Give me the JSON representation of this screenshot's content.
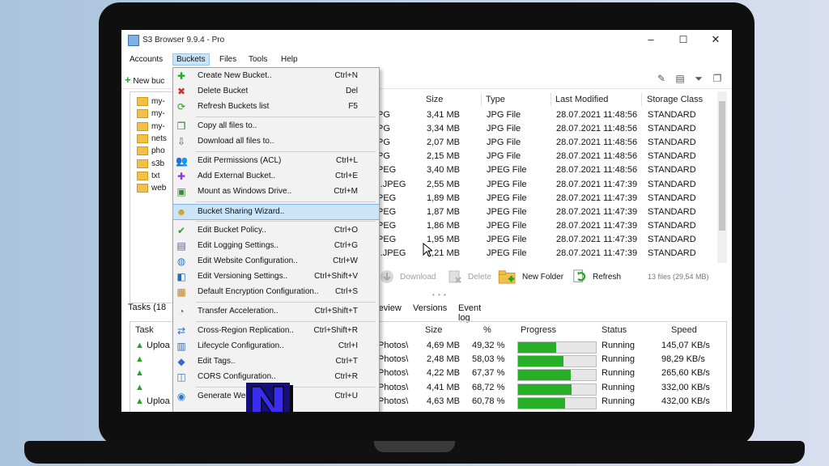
{
  "window": {
    "title": "S3 Browser 9.9.4 - Pro",
    "minimize": "–",
    "maximize": "☐",
    "close": "✕"
  },
  "menubar": {
    "items": [
      "Accounts",
      "Buckets",
      "Files",
      "Tools",
      "Help"
    ],
    "active": "Buckets"
  },
  "toolbar": {
    "new_bucket_label": "New buc",
    "plus": "+"
  },
  "buckets": [
    "my-",
    "my-",
    "my-",
    "nets",
    "pho",
    "s3b",
    "txt",
    "web"
  ],
  "files": {
    "headers": [
      "Size",
      "Type",
      "Last Modified",
      "Storage Class"
    ],
    "rows": [
      {
        "name": "PG",
        "size": "3,41 MB",
        "type": "JPG File",
        "modified": "28.07.2021 11:48:56",
        "storage": "STANDARD"
      },
      {
        "name": "PG",
        "size": "3,34 MB",
        "type": "JPG File",
        "modified": "28.07.2021 11:48:56",
        "storage": "STANDARD"
      },
      {
        "name": "PG",
        "size": "2,07 MB",
        "type": "JPG File",
        "modified": "28.07.2021 11:48:56",
        "storage": "STANDARD"
      },
      {
        "name": "PG",
        "size": "2,15 MB",
        "type": "JPG File",
        "modified": "28.07.2021 11:48:56",
        "storage": "STANDARD"
      },
      {
        "name": "PEG",
        "size": "3,40 MB",
        "type": "JPEG File",
        "modified": "28.07.2021 11:48:56",
        "storage": "STANDARD"
      },
      {
        "name": ").JPEG",
        "size": "2,55 MB",
        "type": "JPEG File",
        "modified": "28.07.2021 11:47:39",
        "storage": "STANDARD"
      },
      {
        "name": "PEG",
        "size": "1,89 MB",
        "type": "JPEG File",
        "modified": "28.07.2021 11:47:39",
        "storage": "STANDARD"
      },
      {
        "name": "PEG",
        "size": "1,87 MB",
        "type": "JPEG File",
        "modified": "28.07.2021 11:47:39",
        "storage": "STANDARD"
      },
      {
        "name": "PEG",
        "size": "1,86 MB",
        "type": "JPEG File",
        "modified": "28.07.2021 11:47:39",
        "storage": "STANDARD"
      },
      {
        "name": "PEG",
        "size": "1,95 MB",
        "type": "JPEG File",
        "modified": "28.07.2021 11:47:39",
        "storage": "STANDARD"
      },
      {
        "name": ").JPEG",
        "size": "1,21 MB",
        "type": "JPEG File",
        "modified": "28.07.2021 11:47:39",
        "storage": "STANDARD"
      }
    ]
  },
  "actions": {
    "download": "Download",
    "delete": "Delete",
    "new_folder": "New Folder",
    "refresh": "Refresh",
    "file_count": "13 files (29,54 MB)",
    "splitter": "• • •"
  },
  "tabs": {
    "tasks": "Tasks (18",
    "items": [
      "review",
      "Versions",
      "Event log"
    ]
  },
  "tasks": {
    "headers": [
      "Task",
      "Size",
      "%",
      "Progress",
      "Status",
      "Speed"
    ],
    "rows": [
      {
        "task": "Uploa",
        "path": "Photos\\",
        "size": "4,69 MB",
        "percent": "49,32 %",
        "progress": 0.4932,
        "status": "Running",
        "speed": "145,07 KB/s"
      },
      {
        "task": "",
        "path": "Photos\\",
        "size": "2,48 MB",
        "percent": "58,03 %",
        "progress": 0.5803,
        "status": "Running",
        "speed": "98,29 KB/s"
      },
      {
        "task": "",
        "path": "Photos\\",
        "size": "4,22 MB",
        "percent": "67,37 %",
        "progress": 0.6737,
        "status": "Running",
        "speed": "265,60 KB/s"
      },
      {
        "task": "",
        "path": "Photos\\",
        "size": "4,41 MB",
        "percent": "68,72 %",
        "progress": 0.6872,
        "status": "Running",
        "speed": "332,00 KB/s"
      },
      {
        "task": "Uploa",
        "path": "Photos\\",
        "size": "4,63 MB",
        "percent": "60,78 %",
        "progress": 0.6078,
        "status": "Running",
        "speed": "432,00 KB/s"
      }
    ]
  },
  "buckets_menu": {
    "items": [
      {
        "label": "Create New Bucket..",
        "shortcut": "Ctrl+N",
        "icon": "plus-icon",
        "glyph": "✚",
        "color": "#22a722"
      },
      {
        "label": "Delete Bucket",
        "shortcut": "Del",
        "icon": "delete-icon",
        "glyph": "✖",
        "color": "#d62b2b"
      },
      {
        "label": "Refresh Buckets list",
        "shortcut": "F5",
        "icon": "refresh-icon",
        "glyph": "⟳",
        "color": "#2a9a2a"
      },
      {
        "sep": true
      },
      {
        "label": "Copy all files to..",
        "shortcut": "",
        "icon": "copy-icon",
        "glyph": "❐",
        "color": "#2a7a2a"
      },
      {
        "label": "Download all files to..",
        "shortcut": "",
        "icon": "download-icon",
        "glyph": "⇩",
        "color": "#2a7a2a"
      },
      {
        "sep": true
      },
      {
        "label": "Edit Permissions (ACL)",
        "shortcut": "Ctrl+L",
        "icon": "users-icon",
        "glyph": "👥",
        "color": "#3a5a9a"
      },
      {
        "label": "Add External Bucket..",
        "shortcut": "Ctrl+E",
        "icon": "add-external-icon",
        "glyph": "✚",
        "color": "#8a3ad0"
      },
      {
        "label": "Mount as Windows Drive..",
        "shortcut": "Ctrl+M",
        "icon": "drive-icon",
        "glyph": "▣",
        "color": "#3a8a3a"
      },
      {
        "sep": true
      },
      {
        "label": "Bucket Sharing Wizard..",
        "shortcut": "",
        "icon": "sharing-wizard-icon",
        "glyph": "☻",
        "color": "#d0a020",
        "highlight": true
      },
      {
        "sep": true
      },
      {
        "label": "Edit Bucket Policy..",
        "shortcut": "Ctrl+O",
        "icon": "policy-icon",
        "glyph": "✔",
        "color": "#22a722"
      },
      {
        "label": "Edit Logging Settings..",
        "shortcut": "Ctrl+G",
        "icon": "logging-icon",
        "glyph": "▤",
        "color": "#5a5a8a"
      },
      {
        "label": "Edit Website Configuration..",
        "shortcut": "Ctrl+W",
        "icon": "website-icon",
        "glyph": "◍",
        "color": "#2a7ad0"
      },
      {
        "label": "Edit Versioning Settings..",
        "shortcut": "Ctrl+Shift+V",
        "icon": "versioning-icon",
        "glyph": "◧",
        "color": "#2a6ab0"
      },
      {
        "label": "Default Encryption Configuration..",
        "shortcut": "Ctrl+S",
        "icon": "encryption-icon",
        "glyph": "▦",
        "color": "#c08020"
      },
      {
        "sep": true
      },
      {
        "label": "Transfer Acceleration..",
        "shortcut": "Ctrl+Shift+T",
        "icon": "gauge-icon",
        "glyph": "◔",
        "color": "#666666"
      },
      {
        "sep": true
      },
      {
        "label": "Cross-Region Replication..",
        "shortcut": "Ctrl+Shift+R",
        "icon": "replication-icon",
        "glyph": "⇄",
        "color": "#2a6ad0"
      },
      {
        "label": "Lifecycle Configuration..",
        "shortcut": "Ctrl+I",
        "icon": "lifecycle-icon",
        "glyph": "▥",
        "color": "#3a6ab0"
      },
      {
        "label": "Edit Tags..",
        "shortcut": "Ctrl+T",
        "icon": "tag-icon",
        "glyph": "◆",
        "color": "#3a6ad0"
      },
      {
        "label": "CORS Configuration..",
        "shortcut": "Ctrl+R",
        "icon": "cors-icon",
        "glyph": "◫",
        "color": "#3a7a9a"
      },
      {
        "sep": true
      },
      {
        "label": "Generate Web URLs..",
        "shortcut": "Ctrl+U",
        "icon": "web-url-icon",
        "glyph": "◉",
        "color": "#2a7ad0"
      }
    ]
  },
  "badge": {
    "letter": "N"
  }
}
